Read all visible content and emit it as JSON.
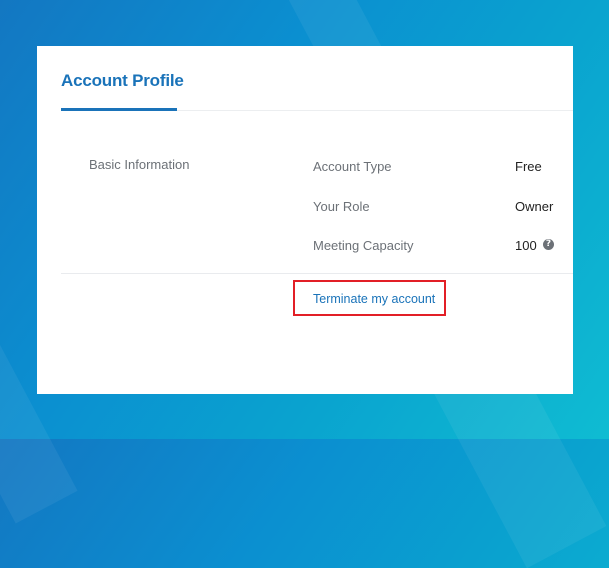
{
  "profile": {
    "tab_title": "Account Profile",
    "section_label": "Basic Information",
    "rows": [
      {
        "label": "Account Type",
        "value": "Free"
      },
      {
        "label": "Your Role",
        "value": "Owner"
      },
      {
        "label": "Meeting Capacity",
        "value": "100"
      }
    ],
    "help_icon": "question-circle-icon",
    "help_glyph": "?",
    "terminate_link": "Terminate my account"
  },
  "colors": {
    "accent": "#1a73b9",
    "highlight_border": "#e21f26",
    "background_gradient_start": "#1377c2",
    "background_gradient_end": "#0fbcd2"
  }
}
